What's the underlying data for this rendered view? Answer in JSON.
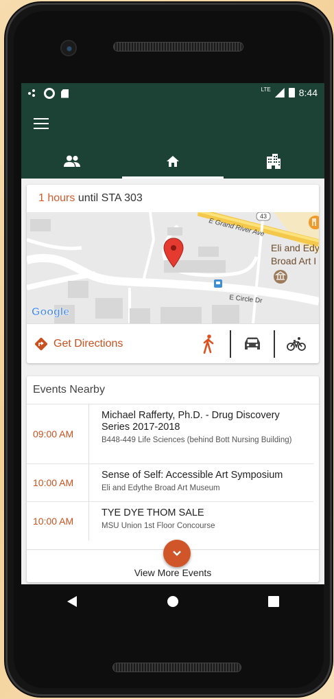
{
  "status_bar": {
    "network": "LTE",
    "time": "8:44"
  },
  "tabs": [
    {
      "icon": "people-icon",
      "active": false
    },
    {
      "icon": "home-icon",
      "active": true
    },
    {
      "icon": "building-icon",
      "active": false
    }
  ],
  "next_class": {
    "hours": "1",
    "hours_unit": "hours",
    "until_text": "until STA 303"
  },
  "map": {
    "road_top": "E Grand River Ave",
    "road_bottom": "E Circle Dr",
    "route_number": "43",
    "place_line1": "Eli and Edy",
    "place_line2": "Broad Art I",
    "logo": "Google"
  },
  "directions": {
    "label": "Get Directions",
    "modes": [
      "walk-icon",
      "car-icon",
      "bike-icon"
    ]
  },
  "events": {
    "header": "Events Nearby",
    "items": [
      {
        "time": "09:00 AM",
        "title": "Michael Rafferty, Ph.D. - Drug Discovery Series 2017-2018",
        "location": "B448-449 Life Sciences  (behind Bott Nursing Building)"
      },
      {
        "time": "10:00 AM",
        "title": "Sense of Self: Accessible Art Symposium",
        "location": "Eli and Edythe Broad Art Museum"
      },
      {
        "time": "10:00 AM",
        "title": "TYE DYE THOM SALE",
        "location": "MSU Union 1st Floor Concourse"
      }
    ],
    "more_label": "View More Events"
  },
  "colors": {
    "primary": "#1c4236",
    "accent": "#d0562a",
    "background": "#f1f1f1"
  }
}
